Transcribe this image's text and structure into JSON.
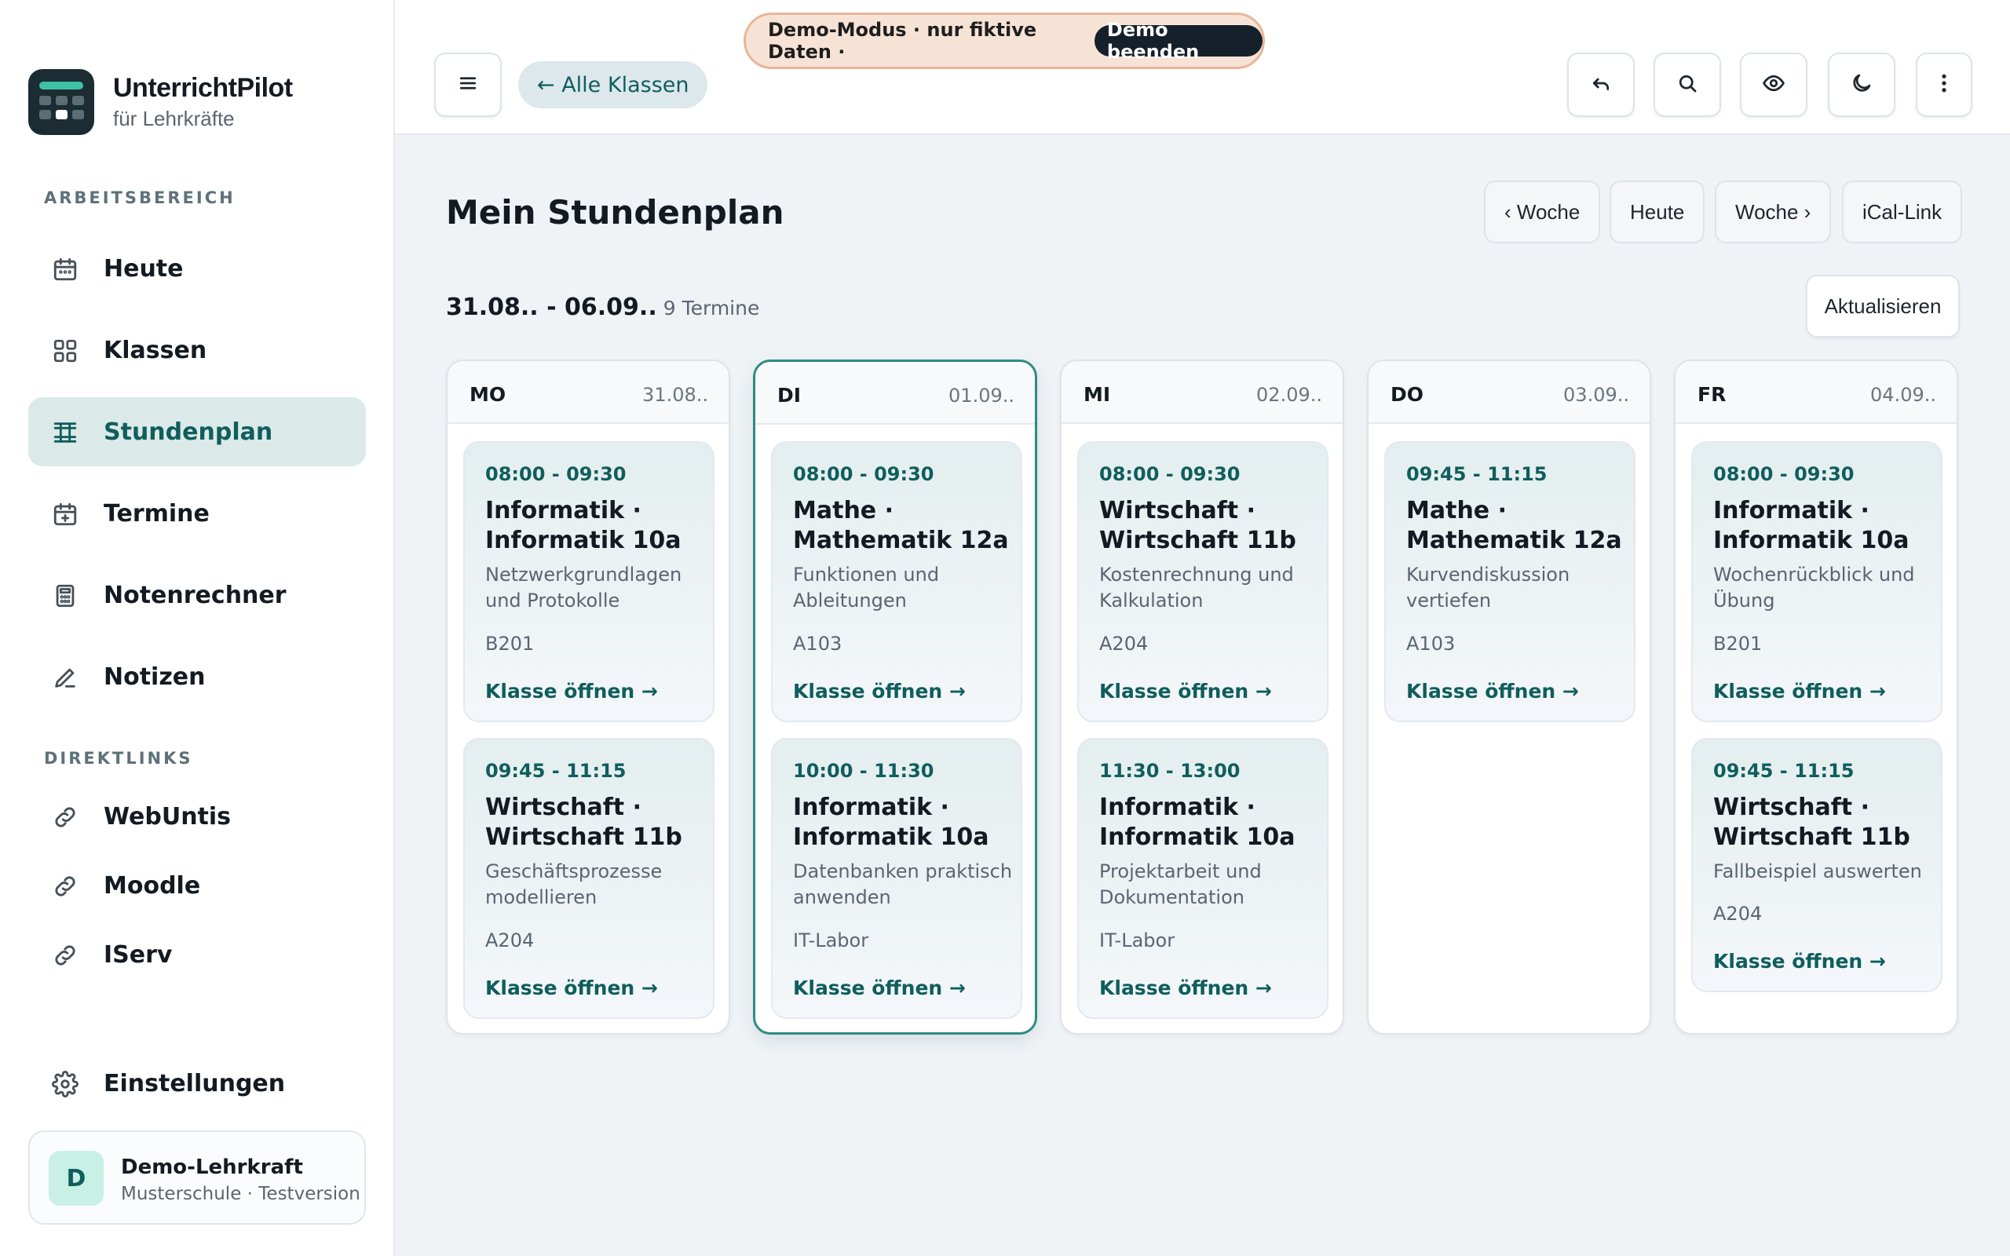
{
  "brand": {
    "name": "UnterrichtPilot",
    "subtitle": "für Lehrkräfte"
  },
  "sidebar": {
    "workspace_label": "ARBEITSBEREICH",
    "items": [
      {
        "label": "Heute",
        "icon": "calendar-icon",
        "active": false
      },
      {
        "label": "Klassen",
        "icon": "grid-icon",
        "active": false
      },
      {
        "label": "Stundenplan",
        "icon": "timetable-icon",
        "active": true
      },
      {
        "label": "Termine",
        "icon": "calendar-plus-icon",
        "active": false
      },
      {
        "label": "Notenrechner",
        "icon": "calculator-icon",
        "active": false
      },
      {
        "label": "Notizen",
        "icon": "pencil-icon",
        "active": false
      }
    ],
    "links_label": "DIREKTLINKS",
    "links": [
      {
        "label": "WebUntis",
        "icon": "link-icon"
      },
      {
        "label": "Moodle",
        "icon": "link-icon"
      },
      {
        "label": "IServ",
        "icon": "link-icon"
      }
    ],
    "settings_label": "Einstellungen"
  },
  "user": {
    "initial": "D",
    "name": "Demo-Lehrkraft",
    "meta": "Musterschule · Testversion"
  },
  "topbar": {
    "back_label": "← Alle Klassen",
    "demo_text": "Demo-Modus · nur fiktive Daten ·",
    "demo_end_label": "Demo beenden",
    "icons": [
      "menu-icon",
      "undo-icon",
      "search-icon",
      "eye-icon",
      "moon-icon",
      "more-vertical-icon"
    ]
  },
  "page": {
    "title": "Mein Stundenplan",
    "nav": {
      "prev_week": "‹ Woche",
      "today": "Heute",
      "next_week": "Woche ›",
      "ical": "iCal-Link"
    },
    "range": "31.08.. - 06.09..",
    "count": "9 Termine",
    "refresh_label": "Aktualisieren"
  },
  "colors": {
    "accent": "#0f5e5c",
    "active_bg": "#dbeae8",
    "banner_bg": "#f7e3d6",
    "banner_border": "#e9b59a",
    "today_border": "#2f8a84"
  },
  "schedule": {
    "days": [
      {
        "name": "MO",
        "date": "31.08..",
        "today": false,
        "events": [
          {
            "time": "08:00 - 09:30",
            "title": "Informatik · Informatik 10a",
            "topic": "Netzwerkgrundlagen und Protokolle",
            "room": "B201",
            "link": "Klasse öffnen →"
          },
          {
            "time": "09:45 - 11:15",
            "title": "Wirtschaft · Wirtschaft 11b",
            "topic": "Geschäftsprozesse modellieren",
            "room": "A204",
            "link": "Klasse öffnen →"
          }
        ]
      },
      {
        "name": "DI",
        "date": "01.09..",
        "today": true,
        "events": [
          {
            "time": "08:00 - 09:30",
            "title": "Mathe · Mathematik 12a",
            "topic": "Funktionen und Ableitungen",
            "room": "A103",
            "link": "Klasse öffnen →"
          },
          {
            "time": "10:00 - 11:30",
            "title": "Informatik · Informatik 10a",
            "topic": "Datenbanken praktisch anwenden",
            "room": "IT-Labor",
            "link": "Klasse öffnen →"
          }
        ]
      },
      {
        "name": "MI",
        "date": "02.09..",
        "today": false,
        "events": [
          {
            "time": "08:00 - 09:30",
            "title": "Wirtschaft · Wirtschaft 11b",
            "topic": "Kostenrechnung und Kalkulation",
            "room": "A204",
            "link": "Klasse öffnen →"
          },
          {
            "time": "11:30 - 13:00",
            "title": "Informatik · Informatik 10a",
            "topic": "Projektarbeit und Dokumentation",
            "room": "IT-Labor",
            "link": "Klasse öffnen →"
          }
        ]
      },
      {
        "name": "DO",
        "date": "03.09..",
        "today": false,
        "events": [
          {
            "time": "09:45 - 11:15",
            "title": "Mathe · Mathematik 12a",
            "topic": "Kurvendiskussion vertiefen",
            "room": "A103",
            "link": "Klasse öffnen →"
          }
        ]
      },
      {
        "name": "FR",
        "date": "04.09..",
        "today": false,
        "events": [
          {
            "time": "08:00 - 09:30",
            "title": "Informatik · Informatik 10a",
            "topic": "Wochenrückblick und Übung",
            "room": "B201",
            "link": "Klasse öffnen →"
          },
          {
            "time": "09:45 - 11:15",
            "title": "Wirtschaft · Wirtschaft 11b",
            "topic": "Fallbeispiel auswerten",
            "room": "A204",
            "link": "Klasse öffnen →"
          }
        ]
      }
    ]
  }
}
